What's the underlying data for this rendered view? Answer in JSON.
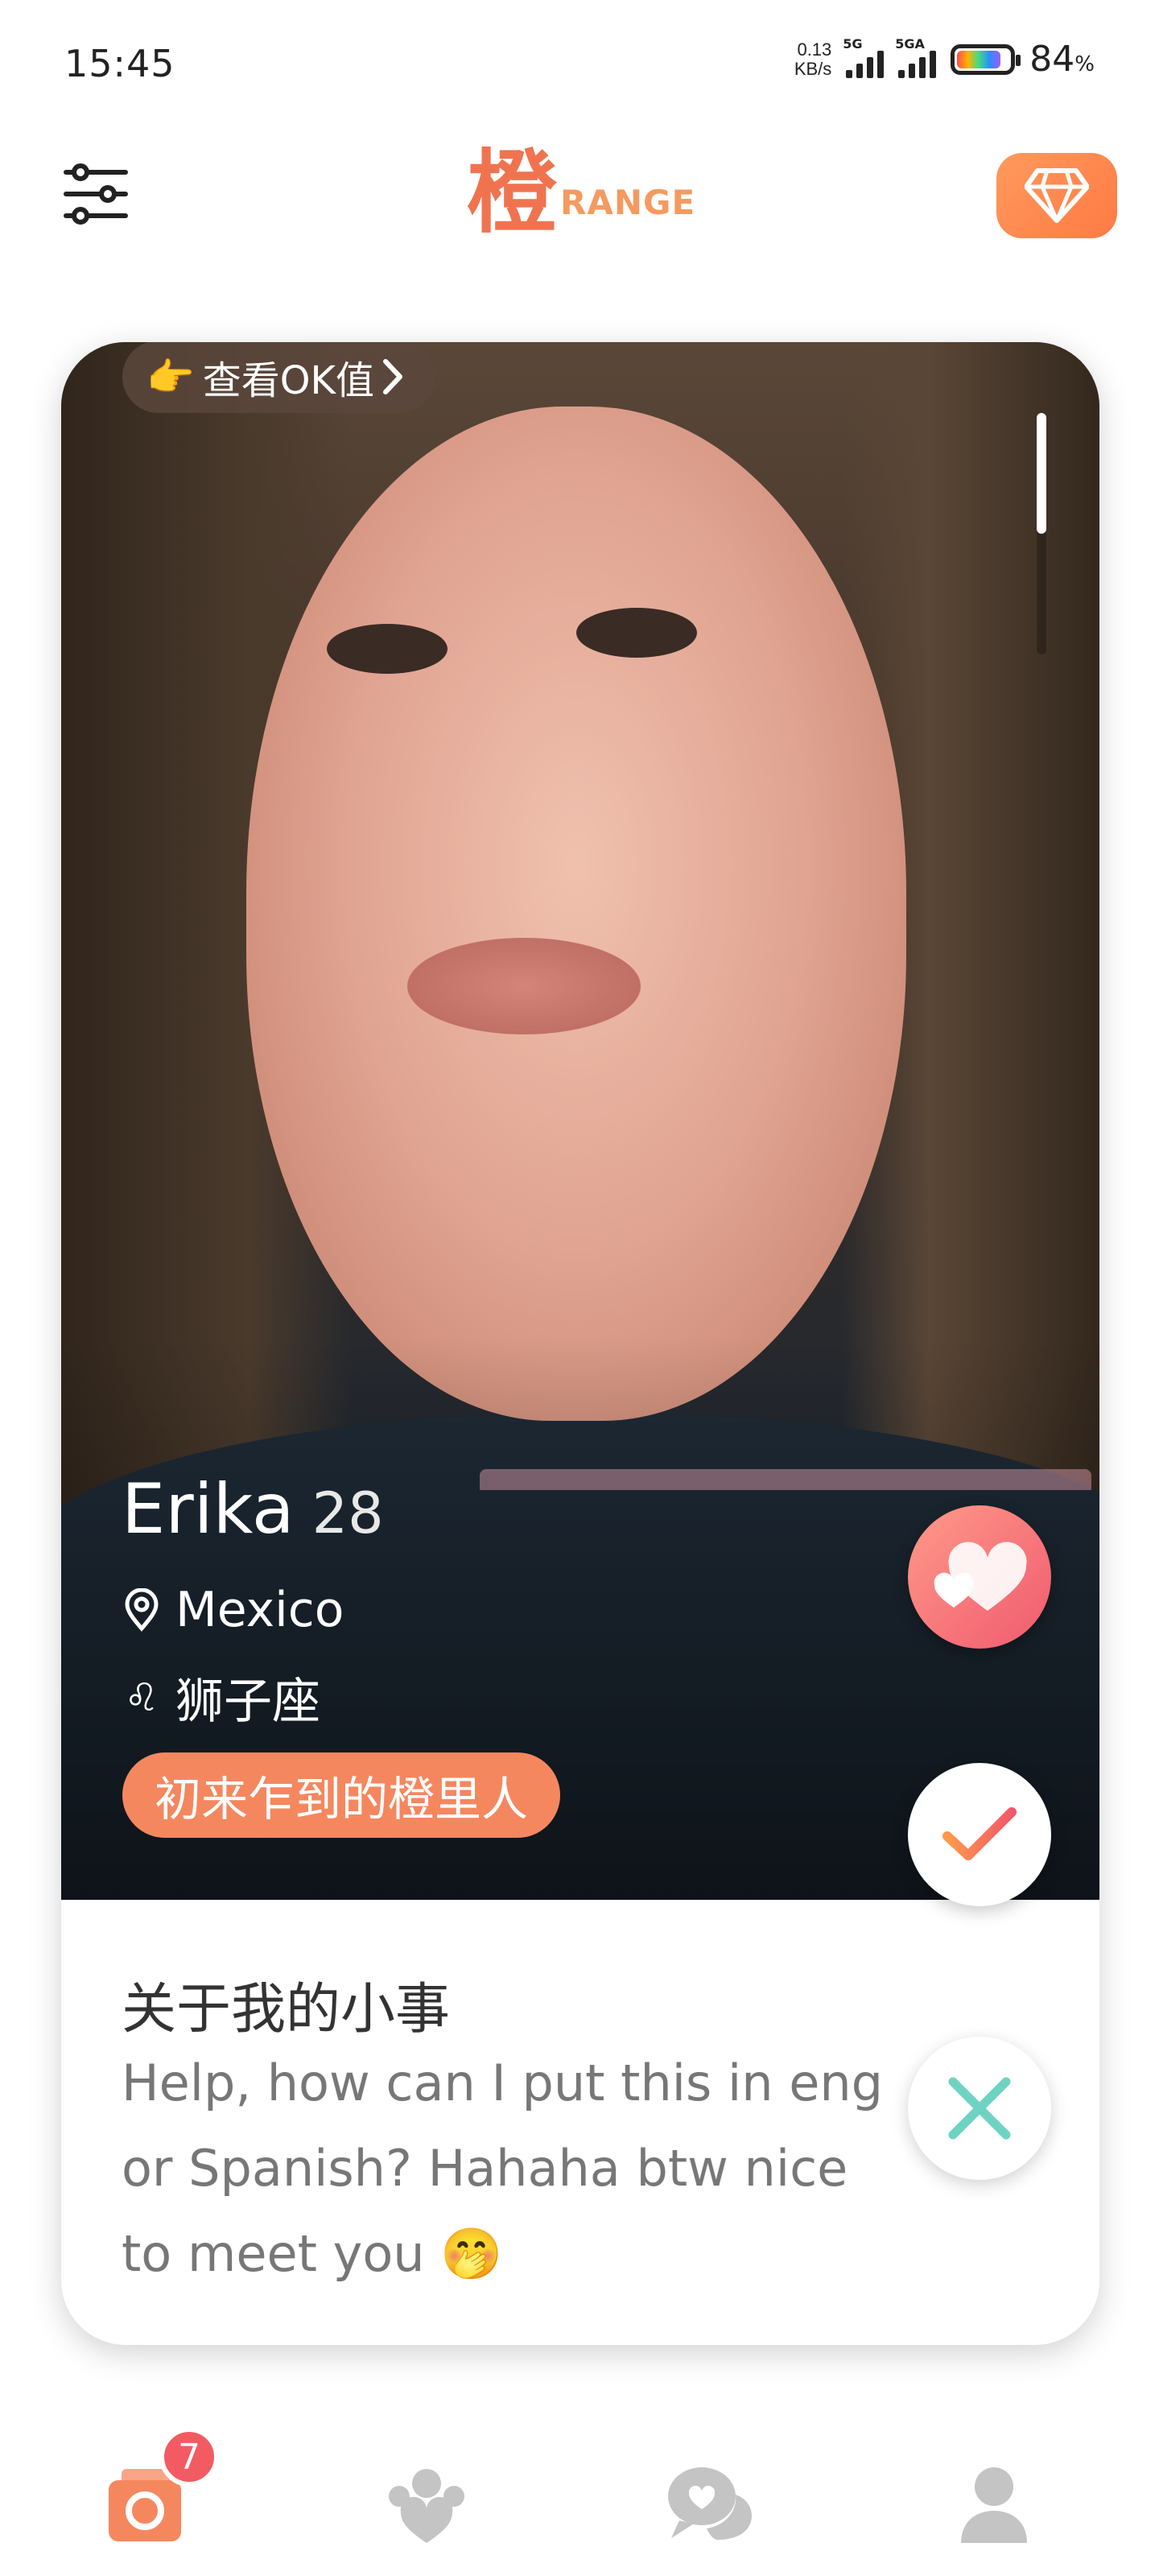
{
  "status_bar": {
    "time": "15:45",
    "net_speed_value": "0.13",
    "net_speed_unit": "KB/s",
    "signal1_label": "5G",
    "signal2_label": "5GA",
    "battery_percent": "84",
    "battery_unit": "%"
  },
  "header": {
    "logo_char": "橙",
    "logo_text": "RANGE",
    "filter_icon": "sliders-icon",
    "vip_icon": "diamond-icon",
    "brand_color": "#f57a4a"
  },
  "card": {
    "ok_button_emoji": "👉",
    "ok_button_label": "查看OK值",
    "name": "Erika",
    "age": "28",
    "location": "Mexico",
    "zodiac_symbol": "♌",
    "zodiac": "狮子座",
    "tag": "初来乍到的橙里人",
    "about_title": "关于我的小事",
    "about_text": "Help, how can I put this in eng or Spanish? Hahaha btw nice to meet you 🤭",
    "photo_page_fraction": 0.5
  },
  "bottom_nav": {
    "items": [
      {
        "icon": "camera-cards-icon",
        "active": true
      },
      {
        "icon": "group-hearts-icon",
        "active": false
      },
      {
        "icon": "chat-bubbles-icon",
        "active": false
      },
      {
        "icon": "profile-icon",
        "active": false
      }
    ],
    "badge_count": "7",
    "active_color": "#f5875f",
    "inactive_color": "#c4c4c4"
  }
}
